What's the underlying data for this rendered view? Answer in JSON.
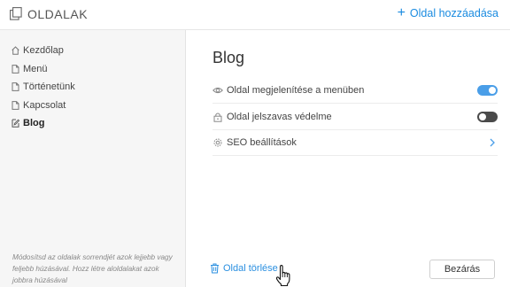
{
  "header": {
    "title": "OLDALAK",
    "add_page_label": "Oldal hozzáadása",
    "icons": {
      "logo": "pages-icon",
      "add": "plus-icon"
    }
  },
  "sidebar": {
    "items": [
      {
        "label": "Kezdőlap",
        "icon": "home-icon",
        "active": false
      },
      {
        "label": "Menü",
        "icon": "page-icon",
        "active": false
      },
      {
        "label": "Történetünk",
        "icon": "page-icon",
        "active": false
      },
      {
        "label": "Kapcsolat",
        "icon": "page-icon",
        "active": false
      },
      {
        "label": "Blog",
        "icon": "blog-edit-icon",
        "active": true
      }
    ],
    "note": "Módosítsd az oldalak sorrendjét azok lejjebb vagy feljebb húzásával. Hozz létre aloldalakat azok jobbra húzásával"
  },
  "main": {
    "heading": "Blog",
    "settings": [
      {
        "label": "Oldal megjelenítése a menüben",
        "icon": "eye-icon",
        "control": "toggle",
        "state": "on"
      },
      {
        "label": "Oldal jelszavas védelme",
        "icon": "lock-icon",
        "control": "toggle",
        "state": "off"
      },
      {
        "label": "SEO beállítások",
        "icon": "gear-icon",
        "control": "chevron"
      }
    ],
    "delete_label": "Oldal törlése",
    "close_label": "Bezárás"
  },
  "colors": {
    "accent": "#1a8be0",
    "toggle_on": "#4a9ee8",
    "toggle_off": "#4a4a4a",
    "sidebar_bg": "#f6f6f6"
  }
}
